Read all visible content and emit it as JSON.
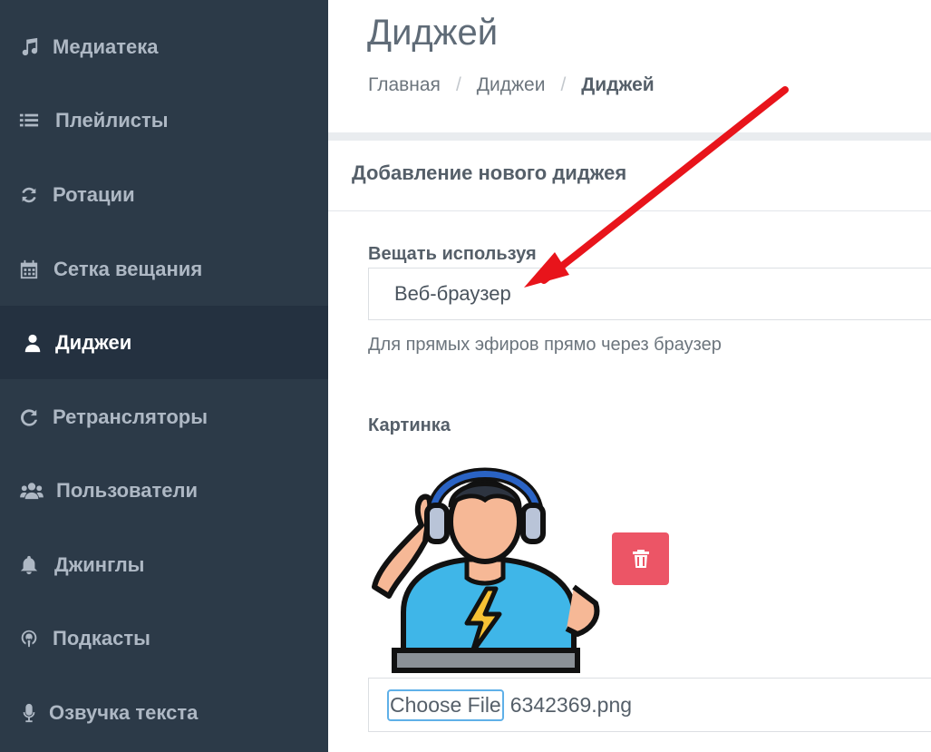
{
  "sidebar": {
    "items": [
      {
        "label": "Медиатека",
        "icon": "music-icon",
        "active": false
      },
      {
        "label": "Плейлисты",
        "icon": "list-icon",
        "active": false
      },
      {
        "label": "Ротации",
        "icon": "refresh-icon",
        "active": false
      },
      {
        "label": "Сетка вещания",
        "icon": "calendar-icon",
        "active": false
      },
      {
        "label": "Диджеи",
        "icon": "user-icon",
        "active": true
      },
      {
        "label": "Ретрансляторы",
        "icon": "redo-icon",
        "active": false
      },
      {
        "label": "Пользователи",
        "icon": "users-icon",
        "active": false
      },
      {
        "label": "Джинглы",
        "icon": "bell-icon",
        "active": false
      },
      {
        "label": "Подкасты",
        "icon": "podcast-icon",
        "active": false
      },
      {
        "label": "Озвучка текста",
        "icon": "microphone-icon",
        "active": false
      }
    ]
  },
  "page": {
    "title": "Диджей",
    "breadcrumb": [
      "Главная",
      "Диджеи",
      "Диджей"
    ]
  },
  "card": {
    "title": "Добавление нового диджея"
  },
  "form": {
    "broadcast_label": "Вещать используя",
    "broadcast_value": "Веб-браузер",
    "broadcast_help": "Для прямых эфиров прямо через браузер",
    "image_label": "Картинка",
    "image_icon": "dj-headphones-illustration",
    "delete_icon": "trash-icon",
    "choose_file_label": "Choose File",
    "file_name": "6342369.png"
  },
  "annotation": {
    "arrow_color": "#e8141b"
  },
  "colors": {
    "sidebar_bg": "#2c3a48",
    "sidebar_active_bg": "#243140",
    "delete_button": "#ec5566"
  }
}
